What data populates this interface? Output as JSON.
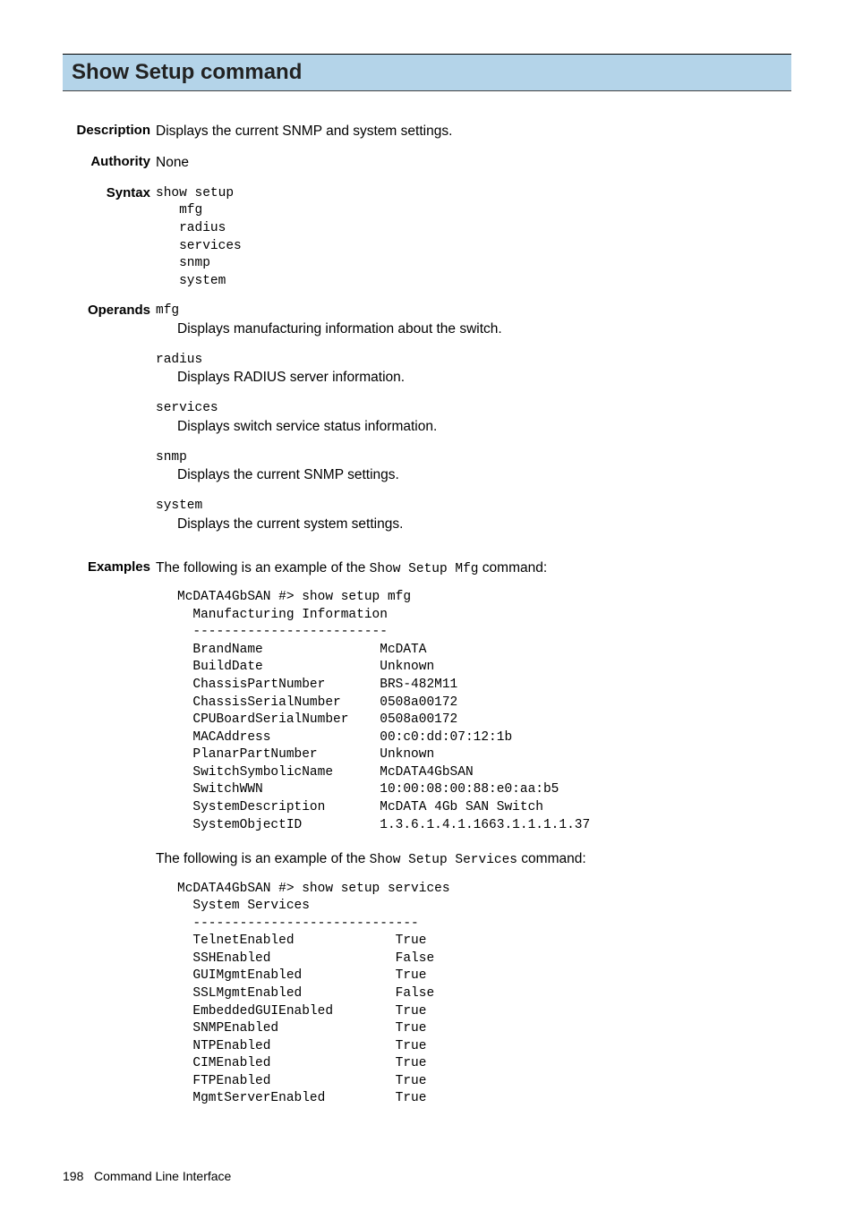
{
  "title": "Show Setup command",
  "description": {
    "label": "Description",
    "text": "Displays the current SNMP and system settings."
  },
  "authority": {
    "label": "Authority",
    "text": "None"
  },
  "syntax": {
    "label": "Syntax",
    "cmd": "show setup",
    "args": [
      "mfg",
      "radius",
      "services",
      "snmp",
      "system"
    ]
  },
  "operands": {
    "label": "Operands",
    "items": [
      {
        "name": "mfg",
        "desc": "Displays manufacturing information about the switch."
      },
      {
        "name": "radius",
        "desc": "Displays RADIUS server information."
      },
      {
        "name": "services",
        "desc": "Displays switch service status information."
      },
      {
        "name": "snmp",
        "desc": "Displays the current SNMP settings."
      },
      {
        "name": "system",
        "desc": "Displays the current system settings."
      }
    ]
  },
  "examples": {
    "label": "Examples",
    "intro1_pre": "The following is an example of the ",
    "intro1_cmd": "Show Setup Mfg",
    "intro1_post": " command:",
    "block1": "McDATA4GbSAN #> show setup mfg\n  Manufacturing Information\n  -------------------------\n  BrandName               McDATA\n  BuildDate               Unknown\n  ChassisPartNumber       BRS-482M11\n  ChassisSerialNumber     0508a00172\n  CPUBoardSerialNumber    0508a00172\n  MACAddress              00:c0:dd:07:12:1b\n  PlanarPartNumber        Unknown\n  SwitchSymbolicName      McDATA4GbSAN\n  SwitchWWN               10:00:08:00:88:e0:aa:b5\n  SystemDescription       McDATA 4Gb SAN Switch\n  SystemObjectID          1.3.6.1.4.1.1663.1.1.1.1.37",
    "intro2_pre": "The following is an example of the ",
    "intro2_cmd": "Show Setup Services",
    "intro2_post": " command:",
    "block2": "McDATA4GbSAN #> show setup services\n  System Services\n  -----------------------------\n  TelnetEnabled             True\n  SSHEnabled                False\n  GUIMgmtEnabled            True\n  SSLMgmtEnabled            False\n  EmbeddedGUIEnabled        True\n  SNMPEnabled               True\n  NTPEnabled                True\n  CIMEnabled                True\n  FTPEnabled                True\n  MgmtServerEnabled         True"
  },
  "footer": {
    "pagenum": "198",
    "text": "Command Line Interface"
  }
}
